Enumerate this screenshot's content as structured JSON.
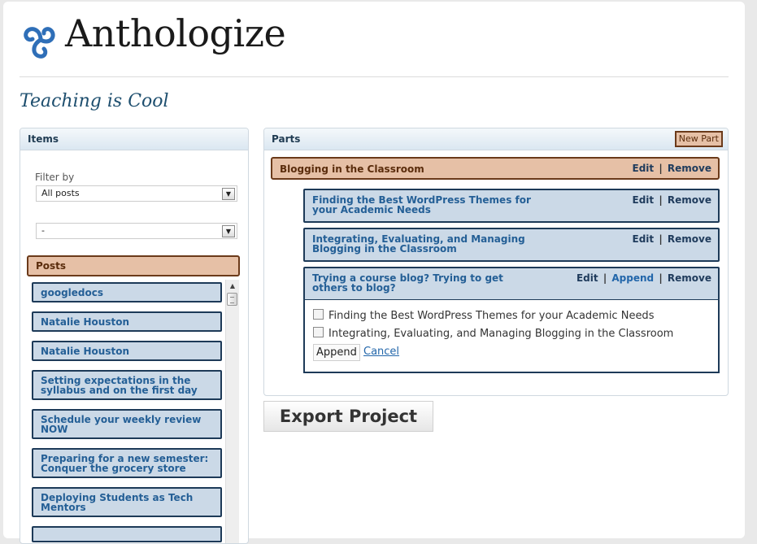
{
  "brand": {
    "name": "Anthologize",
    "logo_icon": "triskelion-icon",
    "color": "#2f6fb8"
  },
  "project": {
    "title": "Teaching is Cool"
  },
  "items_panel": {
    "header": "Items",
    "filter_label": "Filter by",
    "filter_select": "All posts",
    "secondary_select": "-",
    "posts_header": "Posts",
    "posts": [
      "googledocs",
      "Natalie Houston",
      "Natalie Houston",
      "Setting expectations in the syllabus and on the first day",
      "Schedule your weekly review NOW",
      "Preparing for a new semester: Conquer the grocery store",
      "Deploying Students as Tech Mentors"
    ]
  },
  "parts_panel": {
    "header": "Parts",
    "new_part_label": "New Part",
    "part": {
      "title": "Blogging in the Classroom",
      "edit": "Edit",
      "remove": "Remove",
      "separator": "|"
    },
    "part_items": [
      {
        "title": "Finding the Best WordPress Themes for your Academic Needs",
        "edit": "Edit",
        "remove": "Remove"
      },
      {
        "title": "Integrating, Evaluating, and Managing Blogging in the Classroom",
        "edit": "Edit",
        "remove": "Remove"
      },
      {
        "title": "Trying a course blog? Trying to get others to blog?",
        "edit": "Edit",
        "append": "Append",
        "remove": "Remove"
      }
    ],
    "append_panel": {
      "options": [
        "Finding the Best WordPress Themes for your Academic Needs",
        "Integrating, Evaluating, and Managing Blogging in the Classroom"
      ],
      "append_button": "Append",
      "cancel_link": "Cancel"
    }
  },
  "export_button": "Export Project",
  "colors": {
    "part_fill": "#e6c0a6",
    "part_border": "#6b3a1a",
    "item_fill": "#cbd9e7",
    "item_border": "#1d3a58",
    "item_text": "#245f96",
    "title_text": "#1d4e6e"
  }
}
